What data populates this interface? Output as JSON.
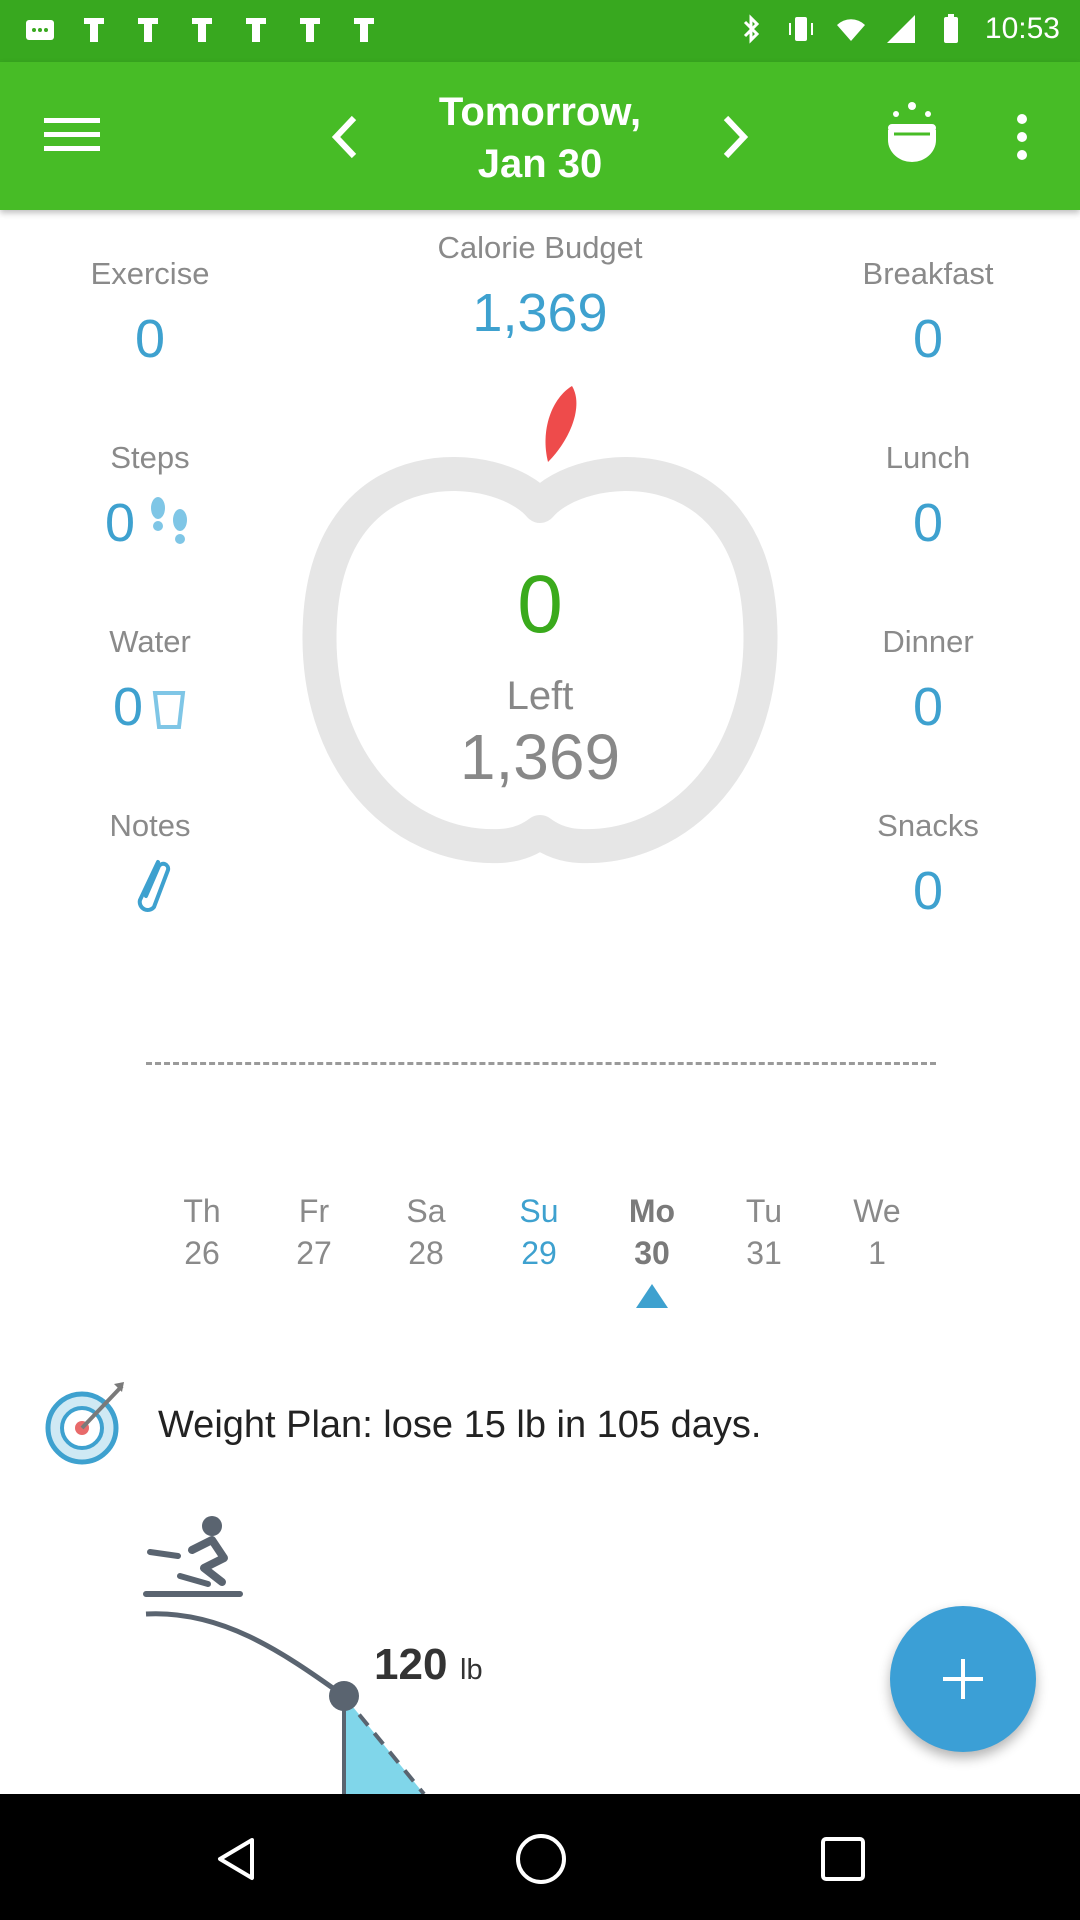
{
  "status_bar": {
    "time": "10:53",
    "left_icons": [
      "message-icon",
      "notification-icon",
      "notification-icon",
      "notification-icon",
      "notification-icon",
      "notification-icon",
      "notification-icon"
    ],
    "right_icons": [
      "bluetooth-icon",
      "vibrate-icon",
      "wifi-icon",
      "signal-icon",
      "battery-icon"
    ]
  },
  "app_bar": {
    "title_line1": "Tomorrow,",
    "title_line2": "Jan 30",
    "icons": [
      "menu-icon",
      "chevron-left-icon",
      "chevron-right-icon",
      "premium-icon",
      "more-vert-icon"
    ]
  },
  "summary": {
    "calorie_budget_label": "Calorie Budget",
    "calorie_budget_value": "1,369",
    "left_column": [
      {
        "label": "Exercise",
        "value": "0"
      },
      {
        "label": "Steps",
        "value": "0"
      },
      {
        "label": "Water",
        "value": "0"
      },
      {
        "label": "Notes",
        "value": ""
      }
    ],
    "right_column": [
      {
        "label": "Breakfast",
        "value": "0"
      },
      {
        "label": "Lunch",
        "value": "0"
      },
      {
        "label": "Dinner",
        "value": "0"
      },
      {
        "label": "Snacks",
        "value": "0"
      }
    ],
    "center_value": "0",
    "left_label": "Left",
    "left_value": "1,369"
  },
  "week_strip": {
    "days": [
      {
        "name": "Th",
        "date": "26"
      },
      {
        "name": "Fr",
        "date": "27"
      },
      {
        "name": "Sa",
        "date": "28"
      },
      {
        "name": "Su",
        "date": "29"
      },
      {
        "name": "Mo",
        "date": "30"
      },
      {
        "name": "Tu",
        "date": "31"
      },
      {
        "name": "We",
        "date": "1"
      }
    ]
  },
  "weight_plan": {
    "text": "Weight Plan: lose 15 lb in 105 days.",
    "weight_value": "120",
    "weight_unit": "lb"
  },
  "colors": {
    "app_bar": "#47bc26",
    "status_bar": "#38a81f",
    "accent_blue": "#3ea1cf",
    "accent_green": "#3aaa1c",
    "apple_stem": "#ee4b4b",
    "fab": "#3b9fd6"
  }
}
